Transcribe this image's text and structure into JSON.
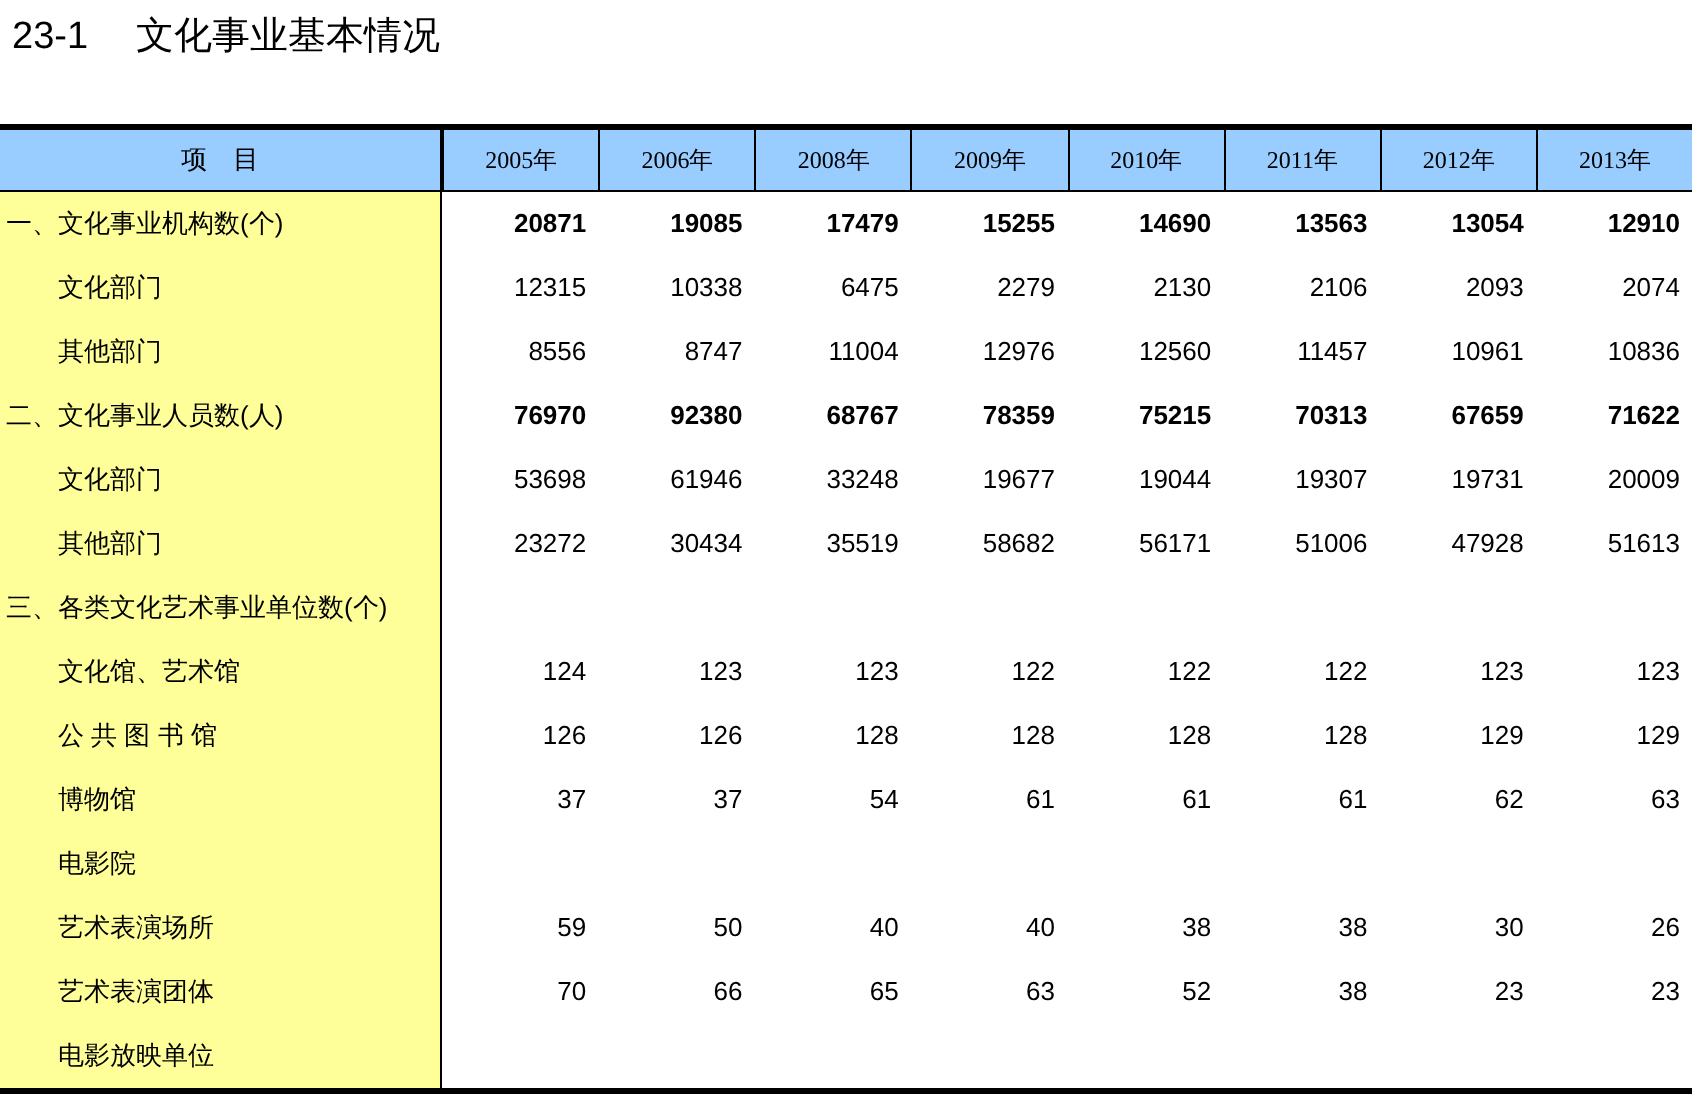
{
  "title": {
    "number": "23-1",
    "text": "文化事业基本情况"
  },
  "table": {
    "columns": [
      "项　目",
      "2005年",
      "2006年",
      "2008年",
      "2009年",
      "2010年",
      "2011年",
      "2012年",
      "2013年"
    ],
    "rows": [
      {
        "kind": "section",
        "label": "一、文化事业机构数(个)",
        "values": [
          "20871",
          "19085",
          "17479",
          "15255",
          "14690",
          "13563",
          "13054",
          "12910"
        ]
      },
      {
        "kind": "item",
        "label": "文化部门",
        "values": [
          "12315",
          "10338",
          "6475",
          "2279",
          "2130",
          "2106",
          "2093",
          "2074"
        ]
      },
      {
        "kind": "item",
        "label": "其他部门",
        "values": [
          "8556",
          "8747",
          "11004",
          "12976",
          "12560",
          "11457",
          "10961",
          "10836"
        ]
      },
      {
        "kind": "section",
        "label": "二、文化事业人员数(人)",
        "values": [
          "76970",
          "92380",
          "68767",
          "78359",
          "75215",
          "70313",
          "67659",
          "71622"
        ]
      },
      {
        "kind": "item",
        "label": "文化部门",
        "values": [
          "53698",
          "61946",
          "33248",
          "19677",
          "19044",
          "19307",
          "19731",
          "20009"
        ]
      },
      {
        "kind": "item",
        "label": "其他部门",
        "values": [
          "23272",
          "30434",
          "35519",
          "58682",
          "56171",
          "51006",
          "47928",
          "51613"
        ]
      },
      {
        "kind": "section",
        "label": "三、各类文化艺术事业单位数(个)"
      },
      {
        "kind": "item",
        "label": "文化馆、艺术馆",
        "values": [
          "124",
          "123",
          "123",
          "122",
          "122",
          "122",
          "123",
          "123"
        ]
      },
      {
        "kind": "item",
        "label": "公 共 图 书 馆",
        "values": [
          "126",
          "126",
          "128",
          "128",
          "128",
          "128",
          "129",
          "129"
        ]
      },
      {
        "kind": "item",
        "label": "博物馆",
        "values": [
          "37",
          "37",
          "54",
          "61",
          "61",
          "61",
          "62",
          "63"
        ]
      },
      {
        "kind": "item",
        "label": "电影院"
      },
      {
        "kind": "item",
        "label": "艺术表演场所",
        "values": [
          "59",
          "50",
          "40",
          "40",
          "38",
          "38",
          "30",
          "26"
        ]
      },
      {
        "kind": "item",
        "label": "艺术表演团体",
        "values": [
          "70",
          "66",
          "65",
          "63",
          "52",
          "38",
          "23",
          "23"
        ]
      },
      {
        "kind": "item",
        "label": "电影放映单位"
      }
    ]
  }
}
